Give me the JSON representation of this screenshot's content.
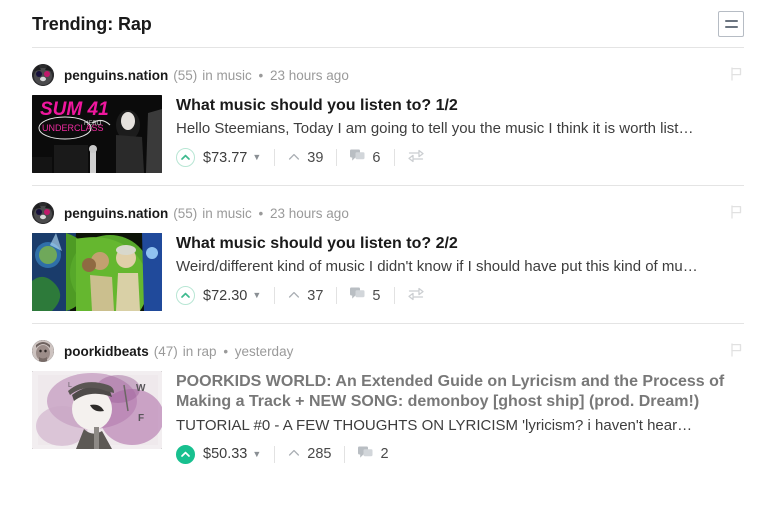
{
  "header": {
    "title": "Trending: Rap",
    "menu_icon": "hamburger-icon"
  },
  "colors": {
    "accent_green": "#18c08f",
    "accent_green_pale": "#b8e6d4",
    "text_dark": "#1a1a1a",
    "text_muted": "#9a9a9a",
    "rule": "#e4e4e4"
  },
  "posts": [
    {
      "author": "penguins.nation",
      "reputation": "(55)",
      "category": "in music",
      "separator": "•",
      "time": "23 hours ago",
      "title": "What music should you listen to? 1/2",
      "summary": "Hello Steemians, Today I am going to tell you the music I think it is worth list…",
      "payout": "$73.77",
      "votes": "39",
      "comments": "6",
      "vote_state": "outline",
      "visited": false,
      "has_resteem": true,
      "thumb_alt": "SUM 41 Underclass Hero album cover",
      "flag_icon": "flag-icon"
    },
    {
      "author": "penguins.nation",
      "reputation": "(55)",
      "category": "in music",
      "separator": "•",
      "time": "23 hours ago",
      "title": "What music should you listen to? 2/2",
      "summary": "Weird/different kind of music I didn't know if I should have put this kind of mu…",
      "payout": "$72.30",
      "votes": "37",
      "comments": "5",
      "vote_state": "outline",
      "visited": false,
      "has_resteem": true,
      "thumb_alt": "Green psychedelic album cover",
      "flag_icon": "flag-icon"
    },
    {
      "author": "poorkidbeats",
      "reputation": "(47)",
      "category": "in rap",
      "separator": "•",
      "time": "yesterday",
      "title": "POORKIDS WORLD: An Extended Guide on Lyricism and the Process of Making a Track + NEW SONG: demonboy [ghost ship] (prod. Dream!)",
      "summary": "TUTORIAL #0 - A FEW THOUGHTS ON LYRICISM 'lyricism? i haven't hear…",
      "payout": "$50.33",
      "votes": "285",
      "comments": "2",
      "vote_state": "filled",
      "visited": true,
      "has_resteem": false,
      "thumb_alt": "Sketch of character with cap on purple watercolor",
      "flag_icon": "flag-icon"
    }
  ]
}
